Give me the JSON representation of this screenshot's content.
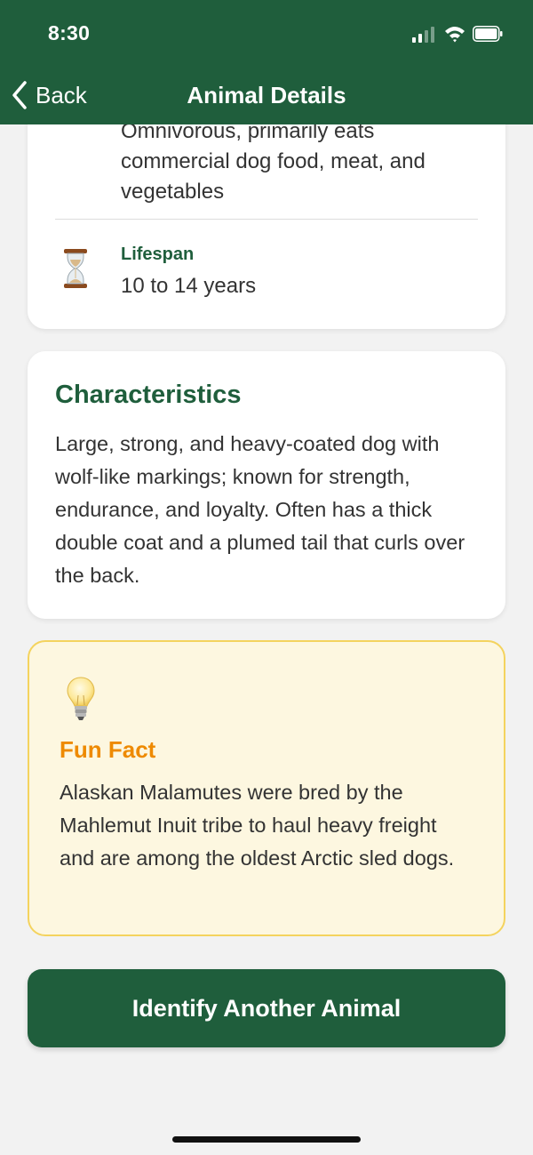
{
  "status_bar": {
    "time": "8:30",
    "icons": [
      "signal-icon",
      "wifi-icon",
      "battery-icon"
    ]
  },
  "nav": {
    "back_label": "Back",
    "title": "Animal Details"
  },
  "info": {
    "diet_partial_line": "Omnivorous, primarily eats",
    "diet_lines": [
      "commercial dog food, meat, and",
      "vegetables"
    ],
    "lifespan_icon": "hourglass-icon",
    "lifespan_label": "Lifespan",
    "lifespan_value": "10 to 14 years"
  },
  "characteristics": {
    "title": "Characteristics",
    "text": "Large, strong, and heavy-coated dog with wolf-like markings; known for strength, endurance, and loyalty. Often has a thick double coat and a plumed tail that curls over the back."
  },
  "fun_fact": {
    "icon": "lightbulb-icon",
    "title": "Fun Fact",
    "text": "Alaskan Malamutes were bred by the Mahlemut Inuit tribe to haul heavy freight and are among the oldest Arctic sled dogs."
  },
  "cta": {
    "label": "Identify Another Animal"
  },
  "colors": {
    "primary": "#1f5e3c",
    "accent": "#ee8a00",
    "fact_background": "#fdf7e0",
    "fact_border": "#f4d35e",
    "page_background": "#f2f2f2"
  }
}
